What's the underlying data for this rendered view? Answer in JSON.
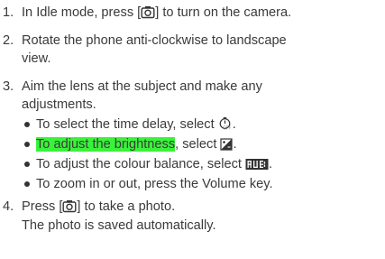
{
  "steps": [
    {
      "num": "1.",
      "parts": [
        "In Idle mode, press [",
        "] to turn on the camera."
      ],
      "key_icon": "camera-icon"
    },
    {
      "num": "2.",
      "lines": [
        "Rotate the phone anti-clockwise to landscape",
        "view."
      ]
    },
    {
      "num": "3.",
      "lines": [
        "Aim the lens at the subject and make any",
        "adjustments."
      ]
    },
    {
      "num": "4.",
      "parts": [
        "Press [",
        "] to take a photo."
      ],
      "key_icon": "camera-icon",
      "line2": "The photo is saved automatically."
    }
  ],
  "bullets": [
    {
      "text": "To select the time delay, select ",
      "icon": "timer-icon",
      "end": "."
    },
    {
      "highlight": "To adjust the brightness",
      "text": ", select ",
      "icon": "exposure-icon",
      "end": "."
    },
    {
      "text": "To adjust the colour balance, select ",
      "icon": "white-balance-awb-icon",
      "end": "."
    },
    {
      "text": "To zoom in or out, press the Volume key."
    }
  ],
  "colors": {
    "highlight": "#3af23a",
    "text": "#3a3a3a"
  }
}
